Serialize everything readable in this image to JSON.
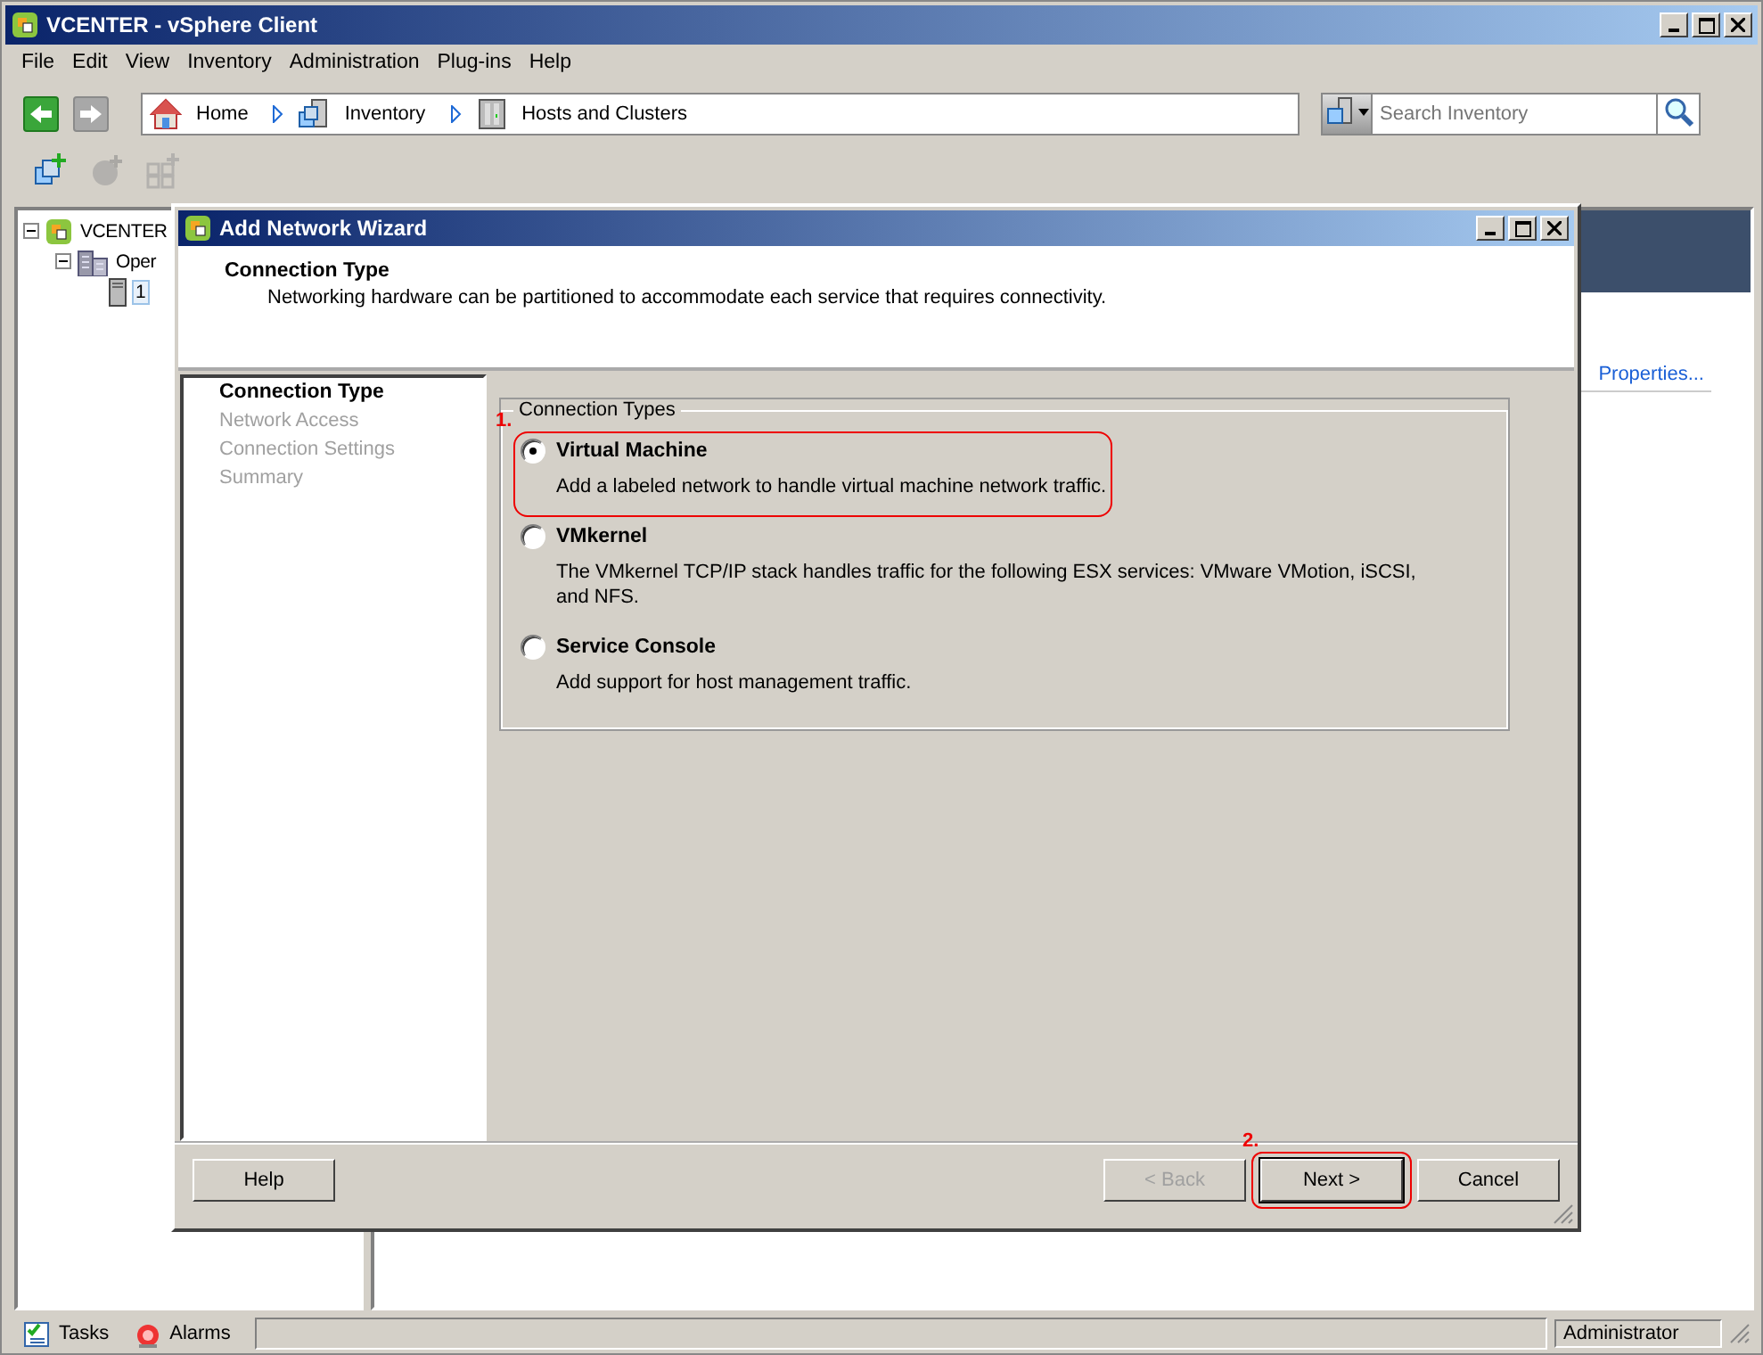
{
  "window": {
    "title": "VCENTER - vSphere Client"
  },
  "menu": [
    "File",
    "Edit",
    "View",
    "Inventory",
    "Administration",
    "Plug-ins",
    "Help"
  ],
  "nav": {
    "back_disabled": false,
    "forward_disabled": true,
    "breadcrumbs": [
      {
        "label": "Home",
        "kind": "home"
      },
      {
        "label": "Inventory",
        "kind": "inventory"
      },
      {
        "label": "Hosts and Clusters",
        "kind": "hosts"
      }
    ]
  },
  "search": {
    "placeholder": "Search Inventory"
  },
  "toolbar": [
    {
      "kind": "add-host",
      "disabled": false
    },
    {
      "kind": "add-vm",
      "disabled": true
    },
    {
      "kind": "add-cluster",
      "disabled": true
    }
  ],
  "tree": [
    {
      "label": "VCENTER",
      "kind": "vcenter",
      "expanded": true,
      "selected": false,
      "children": [
        {
          "label": "Oper",
          "kind": "datacenter",
          "expanded": true,
          "selected": false,
          "children": [
            {
              "label": "1",
              "kind": "host",
              "selected": true
            }
          ]
        }
      ]
    }
  ],
  "right_panel": {
    "link": "Properties..."
  },
  "dialog": {
    "title": "Add Network Wizard",
    "header": {
      "title": "Connection Type",
      "description": "Networking hardware can be partitioned to accommodate each service that requires connectivity."
    },
    "steps": [
      {
        "label": "Connection Type",
        "current": true
      },
      {
        "label": "Network Access",
        "current": false
      },
      {
        "label": "Connection Settings",
        "current": false
      },
      {
        "label": "Summary",
        "current": false
      }
    ],
    "group": {
      "title": "Connection Types",
      "options": [
        {
          "label": "Virtual Machine",
          "description": "Add a labeled network to handle virtual machine network traffic.",
          "selected": true,
          "annotation": "1."
        },
        {
          "label": "VMkernel",
          "description": "The VMkernel TCP/IP stack handles traffic for the following ESX services: VMware VMotion, iSCSI, and NFS.",
          "selected": false
        },
        {
          "label": "Service Console",
          "description": "Add support for host management traffic.",
          "selected": false
        }
      ]
    },
    "help_button": {
      "label": "Help"
    },
    "buttons": [
      {
        "label": "< Back",
        "disabled": true,
        "default": false
      },
      {
        "label": "Next >",
        "disabled": false,
        "default": true,
        "annotation": "2."
      },
      {
        "label": "Cancel",
        "disabled": false,
        "default": false
      }
    ]
  },
  "status_bar": {
    "items": [
      {
        "label": "Tasks",
        "kind": "tasks"
      },
      {
        "label": "Alarms",
        "kind": "alarms"
      }
    ],
    "user": "Administrator"
  }
}
